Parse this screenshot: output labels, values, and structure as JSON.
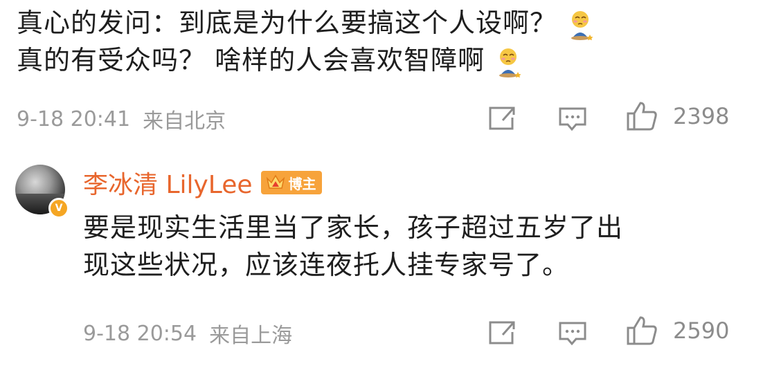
{
  "comment1": {
    "line1": "真心的发问：到底是为什么要搞这个人设啊？",
    "line2": "真的有受众吗？  啥样的人会喜欢智障啊",
    "emoji_icon": "kneeling-sad-emoji",
    "time": "9-18 20:41",
    "location": "来自北京",
    "like_count": "2398"
  },
  "reply": {
    "username": "李冰清 LilyLee",
    "badge_label": "博主",
    "verified_icon": "v-verified-badge",
    "line1": "要是现实生活里当了家长，孩子超过五岁了出",
    "line2": "现这些状况，应该连夜托人挂专家号了。",
    "time": "9-18 20:54",
    "location": "来自上海",
    "like_count": "2590"
  },
  "colors": {
    "username": "#e8662d",
    "badge": "#f7a33b",
    "meta": "#9a9a9a"
  }
}
